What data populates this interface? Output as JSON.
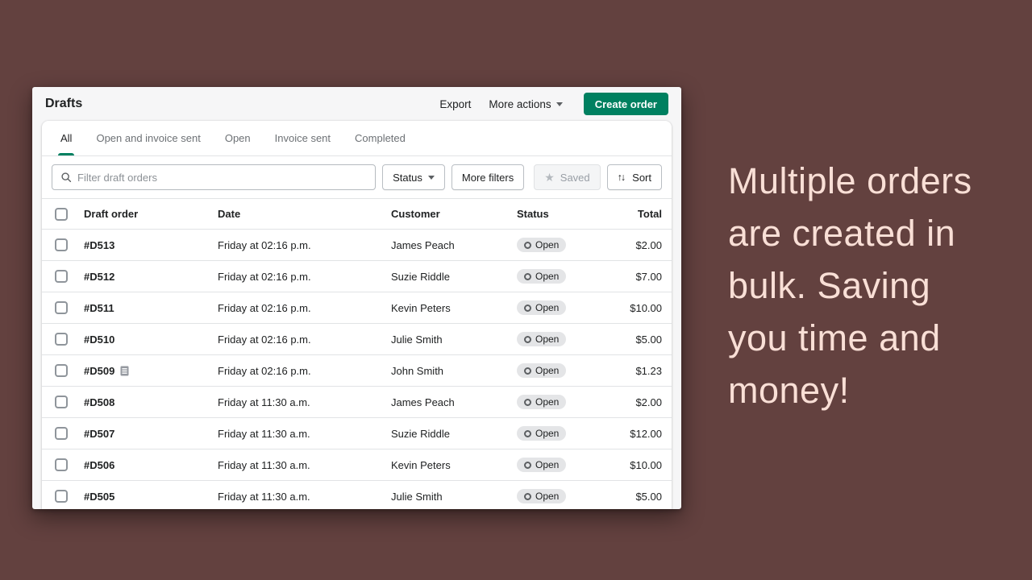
{
  "colors": {
    "background": "#63413f",
    "promo_text": "#f9dfd6",
    "accent_green": "#008060",
    "badge_bg": "#e4e5e7"
  },
  "window": {
    "title": "Drafts",
    "header_actions": {
      "export": "Export",
      "more_actions": "More actions",
      "create_order": "Create order"
    }
  },
  "tabs": [
    {
      "label": "All",
      "active": true
    },
    {
      "label": "Open and invoice sent",
      "active": false
    },
    {
      "label": "Open",
      "active": false
    },
    {
      "label": "Invoice sent",
      "active": false
    },
    {
      "label": "Completed",
      "active": false
    }
  ],
  "filters": {
    "search_placeholder": "Filter draft orders",
    "status": "Status",
    "more_filters": "More filters",
    "saved": "Saved",
    "sort": "Sort"
  },
  "table": {
    "headers": {
      "draft_order": "Draft order",
      "date": "Date",
      "customer": "Customer",
      "status": "Status",
      "total": "Total"
    },
    "rows": [
      {
        "id": "#D513",
        "date": "Friday at 02:16 p.m.",
        "customer": "James Peach",
        "status": "Open",
        "total": "$2.00",
        "has_note": false
      },
      {
        "id": "#D512",
        "date": "Friday at 02:16 p.m.",
        "customer": "Suzie Riddle",
        "status": "Open",
        "total": "$7.00",
        "has_note": false
      },
      {
        "id": "#D511",
        "date": "Friday at 02:16 p.m.",
        "customer": "Kevin Peters",
        "status": "Open",
        "total": "$10.00",
        "has_note": false
      },
      {
        "id": "#D510",
        "date": "Friday at 02:16 p.m.",
        "customer": "Julie Smith",
        "status": "Open",
        "total": "$5.00",
        "has_note": false
      },
      {
        "id": "#D509",
        "date": "Friday at 02:16 p.m.",
        "customer": "John Smith",
        "status": "Open",
        "total": "$1.23",
        "has_note": true
      },
      {
        "id": "#D508",
        "date": "Friday at 11:30 a.m.",
        "customer": "James Peach",
        "status": "Open",
        "total": "$2.00",
        "has_note": false
      },
      {
        "id": "#D507",
        "date": "Friday at 11:30 a.m.",
        "customer": "Suzie Riddle",
        "status": "Open",
        "total": "$12.00",
        "has_note": false
      },
      {
        "id": "#D506",
        "date": "Friday at 11:30 a.m.",
        "customer": "Kevin Peters",
        "status": "Open",
        "total": "$10.00",
        "has_note": false
      },
      {
        "id": "#D505",
        "date": "Friday at 11:30 a.m.",
        "customer": "Julie Smith",
        "status": "Open",
        "total": "$5.00",
        "has_note": false
      }
    ]
  },
  "promo": {
    "lines": [
      "Multiple orders",
      "are created in",
      "bulk. Saving",
      "you time and",
      "money!"
    ]
  }
}
